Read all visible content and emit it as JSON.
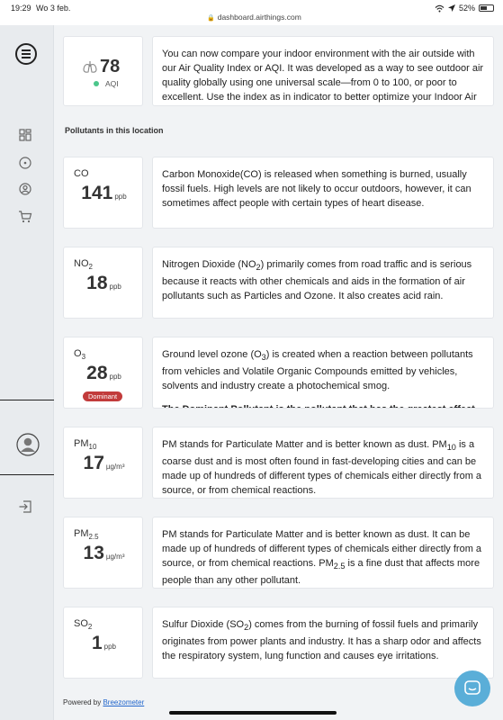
{
  "status_bar": {
    "time": "19:29",
    "date": "Wo 3 feb.",
    "url": "dashboard.airthings.com",
    "battery": "52%",
    "battery_level": 0.52
  },
  "sidebar": {
    "items": [
      {
        "name": "dashboard",
        "icon": "grid-icon"
      },
      {
        "name": "compass",
        "icon": "compass-icon"
      },
      {
        "name": "account",
        "icon": "account-circle-icon"
      },
      {
        "name": "shop",
        "icon": "cart-icon"
      },
      {
        "name": "profile",
        "icon": "user-avatar-icon"
      },
      {
        "name": "logout",
        "icon": "logout-icon"
      }
    ]
  },
  "aqi": {
    "value": "78",
    "label": "AQI",
    "status_color": "#4cc68b",
    "description": "You can now compare your indoor environment with the air outside with our Air Quality Index or AQI. It was developed as a way to see outdoor air quality globally using one universal scale—from 0 to 100, or poor to excellent. Use the index as in indicator to better optimize your Indoor Air Quality. The heat-map above depicts the outdoor air quality in your area."
  },
  "section_title": "Pollutants in this location",
  "pollutants": [
    {
      "name": "CO",
      "sub": "",
      "value": "141",
      "unit": "ppb",
      "description": "Carbon Monoxide(CO) is released when something is burned, usually fossil fuels. High levels are not likely to occur outdoors, however, it can sometimes affect people with certain types of heart disease."
    },
    {
      "name": "NO",
      "sub": "2",
      "value": "18",
      "unit": "ppb",
      "desc_parts": [
        "Nitrogen Dioxide (NO",
        "2",
        ") primarily comes from road traffic and is serious because it reacts with other chemicals and aids in the formation of air pollutants such as Particles and Ozone. It also creates acid rain."
      ]
    },
    {
      "name": "O",
      "sub": "3",
      "value": "28",
      "unit": "ppb",
      "badge": "Dominant",
      "desc_parts": [
        "Ground level ozone (O",
        "3",
        ") is created when a reaction between pollutants from vehicles and Volatile Organic Compounds emitted by vehicles, solvents and industry create a photochemical smog."
      ],
      "bold": "The Dominant Pollutant is the pollutant that has the greatest effect on"
    },
    {
      "name": "PM",
      "sub": "10",
      "value": "17",
      "unit": "µg/m³",
      "desc_parts": [
        "PM stands for Particulate Matter and is better known as dust. PM",
        "10",
        " is a coarse dust and is most often found in fast-developing cities and can be made up of hundreds of different types of chemicals either directly from a source, or from chemical reactions."
      ]
    },
    {
      "name": "PM",
      "sub": "2.5",
      "value": "13",
      "unit": "µg/m³",
      "desc_parts": [
        "PM stands for Particulate Matter and is better known as dust. It can be made up of hundreds of different types of chemicals either directly from a source, or from chemical reactions. PM",
        "2.5",
        " is a fine dust that affects more people than any other pollutant."
      ]
    },
    {
      "name": "SO",
      "sub": "2",
      "value": "1",
      "unit": "ppb",
      "desc_parts": [
        "Sulfur Dioxide (SO",
        "2",
        ") comes from the burning of fossil fuels and primarily originates from power plants and industry. It has a sharp odor and affects the respiratory system, lung function and causes eye irritations."
      ]
    }
  ],
  "footer": {
    "powered_by": "Powered by ",
    "link_text": "Breezometer"
  },
  "colors": {
    "dominant_badge": "#c23b3b",
    "chat_button": "#5aaed8",
    "link": "#2266cc"
  }
}
